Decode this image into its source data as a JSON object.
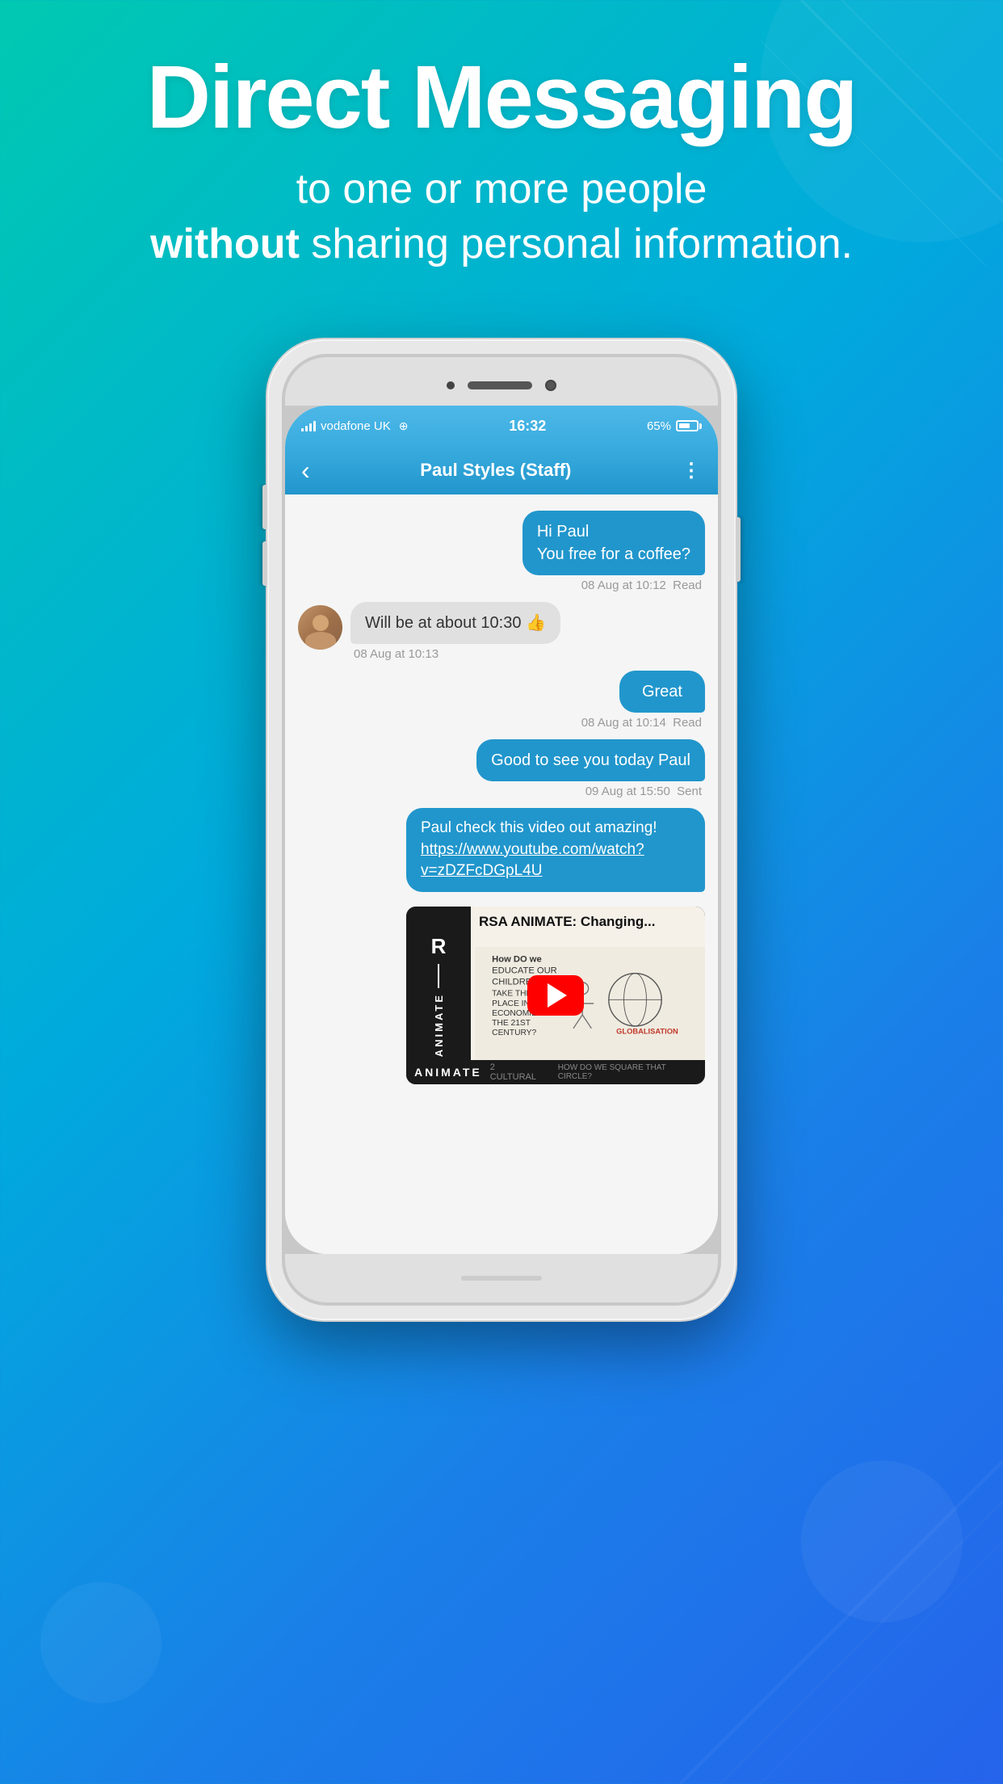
{
  "header": {
    "title": "Direct Messaging",
    "subtitle_line1": "to one or more people",
    "subtitle_bold": "without",
    "subtitle_line2": " sharing personal information."
  },
  "status_bar": {
    "carrier": "vodafone UK",
    "time": "16:32",
    "battery": "65%"
  },
  "nav": {
    "title": "Paul Styles (Staff)",
    "back_label": "‹",
    "more_label": "⋮"
  },
  "messages": [
    {
      "id": "msg1",
      "type": "sent",
      "text": "Hi Paul\nYou free for a coffee?",
      "timestamp": "08 Aug at 10:12",
      "status": "Read"
    },
    {
      "id": "msg2",
      "type": "received",
      "text": "Will be at about 10:30 👍",
      "timestamp": "08 Aug at 10:13",
      "status": ""
    },
    {
      "id": "msg3",
      "type": "sent",
      "text": "Great",
      "timestamp": "08 Aug at 10:14",
      "status": "Read"
    },
    {
      "id": "msg4",
      "type": "sent",
      "text": "Good to see you today Paul",
      "timestamp": "09 Aug at 15:50",
      "status": "Sent"
    },
    {
      "id": "msg5",
      "type": "sent_link",
      "text": "Paul check this video out amazing!",
      "link_text": "https://www.youtube.com/watch?v=zDZFcDGpL4U",
      "timestamp": "",
      "status": ""
    }
  ],
  "video": {
    "title": "RSA ANIMATE: Changing",
    "channel": "RSA ANIMATE",
    "label": "ANIMATE"
  },
  "icons": {
    "back": "‹",
    "more": "⋮",
    "wifi": "📶",
    "play": "▶"
  }
}
